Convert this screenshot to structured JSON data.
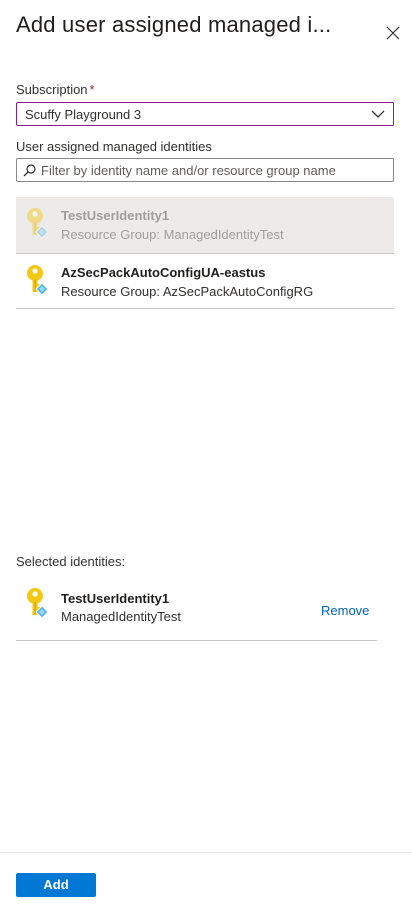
{
  "panel": {
    "title": "Add user assigned managed i...",
    "close_icon": "close-icon"
  },
  "subscription": {
    "label": "Subscription",
    "required_mark": "*",
    "value": "Scuffy Playground 3",
    "icon": "chevron-down-icon"
  },
  "identities": {
    "label": "User assigned managed identities",
    "search_placeholder": "Filter by identity name and/or resource group name",
    "search_value": "",
    "items": [
      {
        "name": "TestUserIdentity1",
        "group": "Resource Group: ManagedIdentityTest",
        "state": "selected-disabled"
      },
      {
        "name": "AzSecPackAutoConfigUA-eastus",
        "group": "Resource Group: AzSecPackAutoConfigRG",
        "state": "available"
      }
    ]
  },
  "selected": {
    "label": "Selected identities:",
    "items": [
      {
        "name": "TestUserIdentity1",
        "group": "ManagedIdentityTest",
        "action": "Remove"
      }
    ]
  },
  "footer": {
    "add_label": "Add"
  },
  "colors": {
    "accent": "#0078d4",
    "link": "#0063b1",
    "select_border": "#8a1e8a",
    "key_gold": "#f2c811",
    "key_diamond": "#50b6e8"
  }
}
